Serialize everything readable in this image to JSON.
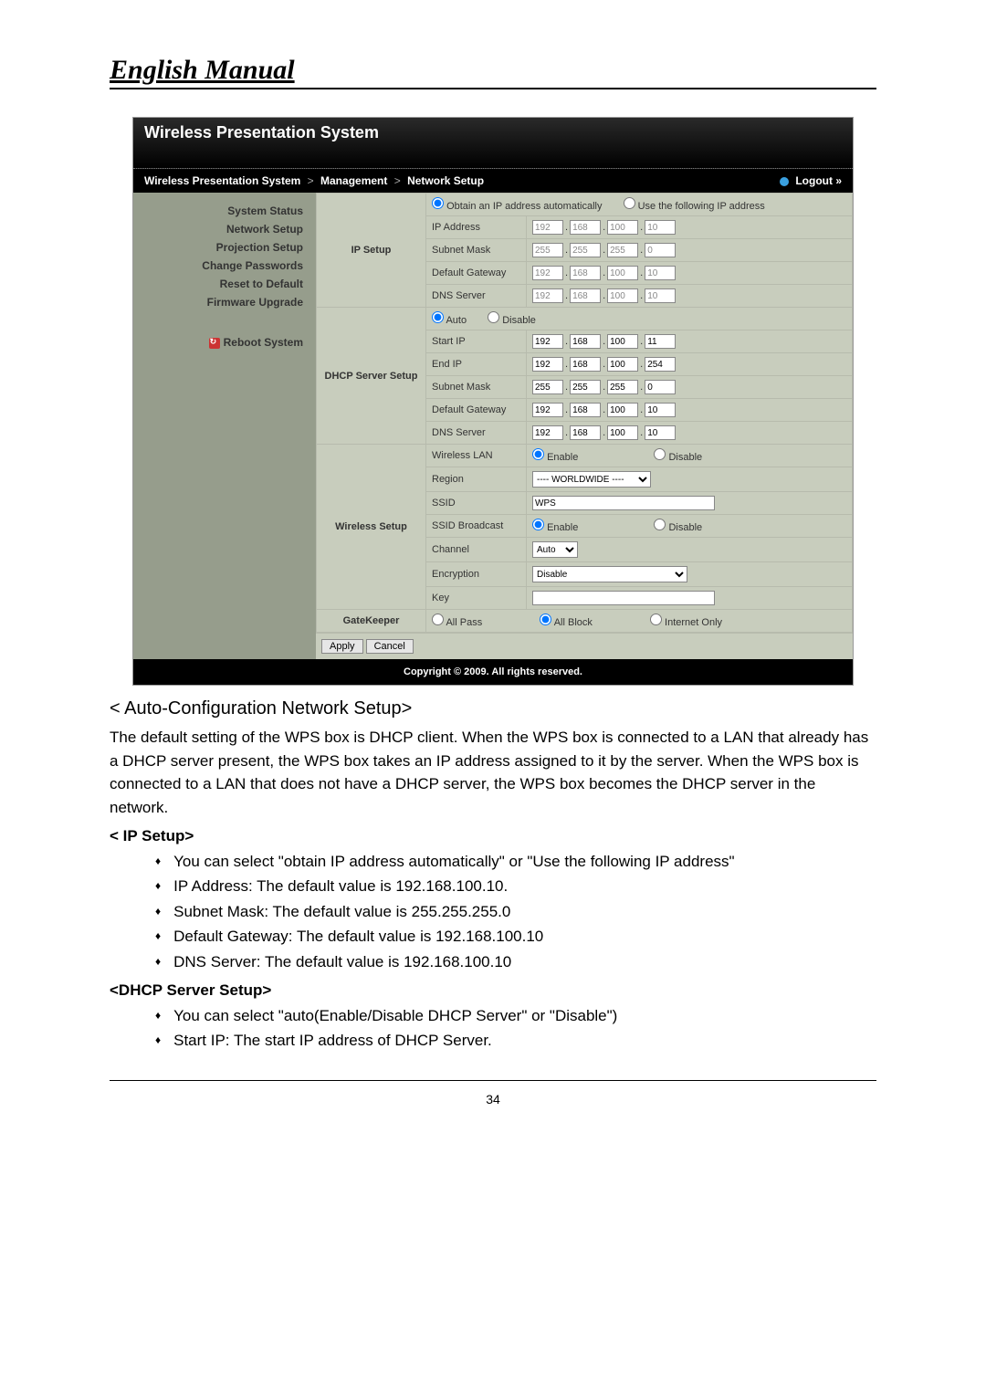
{
  "doc_title": "English Manual",
  "screenshot": {
    "title": "Wireless Presentation System",
    "breadcrumb": [
      "Wireless Presentation System",
      "Management",
      "Network Setup"
    ],
    "logout": "Logout »",
    "sidebar": {
      "items": [
        "System Status",
        "Network Setup",
        "Projection Setup",
        "Change Passwords",
        "Reset to Default",
        "Firmware Upgrade"
      ],
      "reboot": "Reboot System"
    },
    "ip_setup": {
      "section": "IP Setup",
      "mode_auto": "Obtain an IP address automatically",
      "mode_static": "Use the following IP address",
      "rows": {
        "ip_address": {
          "label": "IP Address",
          "v": [
            "192",
            "168",
            "100",
            "10"
          ]
        },
        "subnet": {
          "label": "Subnet Mask",
          "v": [
            "255",
            "255",
            "255",
            "0"
          ]
        },
        "gateway": {
          "label": "Default Gateway",
          "v": [
            "192",
            "168",
            "100",
            "10"
          ]
        },
        "dns": {
          "label": "DNS Server",
          "v": [
            "192",
            "168",
            "100",
            "10"
          ]
        }
      }
    },
    "dhcp": {
      "section": "DHCP Server Setup",
      "auto": "Auto",
      "disable": "Disable",
      "rows": {
        "start": {
          "label": "Start IP",
          "v": [
            "192",
            "168",
            "100",
            "11"
          ]
        },
        "end": {
          "label": "End IP",
          "v": [
            "192",
            "168",
            "100",
            "254"
          ]
        },
        "subnet": {
          "label": "Subnet Mask",
          "v": [
            "255",
            "255",
            "255",
            "0"
          ]
        },
        "gateway": {
          "label": "Default Gateway",
          "v": [
            "192",
            "168",
            "100",
            "10"
          ]
        },
        "dns": {
          "label": "DNS Server",
          "v": [
            "192",
            "168",
            "100",
            "10"
          ]
        }
      }
    },
    "wireless": {
      "section": "Wireless Setup",
      "wlan_label": "Wireless LAN",
      "enable": "Enable",
      "disable": "Disable",
      "region_label": "Region",
      "region_value": "---- WORLDWIDE ----",
      "ssid_label": "SSID",
      "ssid_value": "WPS",
      "ssid_bcast_label": "SSID Broadcast",
      "channel_label": "Channel",
      "channel_value": "Auto",
      "encryption_label": "Encryption",
      "encryption_value": "Disable",
      "key_label": "Key",
      "key_value": ""
    },
    "gatekeeper": {
      "section": "GateKeeper",
      "all_pass": "All Pass",
      "all_block": "All Block",
      "internet_only": "Internet Only"
    },
    "buttons": {
      "apply": "Apply",
      "cancel": "Cancel"
    },
    "copyright": "Copyright © 2009. All rights reserved."
  },
  "doc": {
    "caption": "< Auto-Configuration Network Setup>",
    "para1": "The default setting of the WPS box is DHCP client. When the WPS box is connected to a LAN that already has a DHCP server present, the WPS box takes an IP address assigned to it by the server. When the WPS box is connected to a LAN that does not have a DHCP server, the WPS box becomes the DHCP server in the network.",
    "ip_head": "< IP Setup>",
    "ip_bullets": [
      "You can select \"obtain IP address automatically\" or \"Use the following IP address\"",
      "IP Address: The default value is 192.168.100.10.",
      "Subnet Mask: The default value is 255.255.255.0",
      "Default Gateway: The default value is 192.168.100.10",
      "DNS Server: The default value is 192.168.100.10"
    ],
    "dhcp_head": "<DHCP Server Setup>",
    "dhcp_bullets": [
      "You can select \"auto(Enable/Disable DHCP Server\" or \"Disable\")",
      "Start IP: The start IP address of DHCP Server."
    ]
  },
  "page_number": "34"
}
